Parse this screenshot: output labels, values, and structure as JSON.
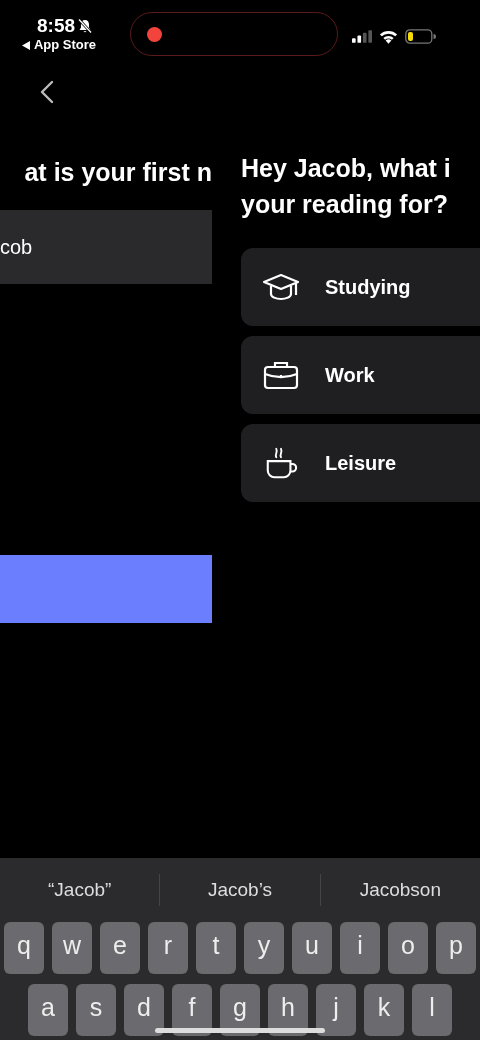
{
  "status_bar": {
    "time": "8:58",
    "back_label": "App Store"
  },
  "previous_page": {
    "heading": "at is your first n",
    "name_field": {
      "value": "cob"
    }
  },
  "current_page": {
    "heading_lines": [
      "Hey Jacob, what i",
      "your reading for?"
    ],
    "options": [
      {
        "kind": "cap",
        "label": "Studying"
      },
      {
        "kind": "briefcase",
        "label": "Work"
      },
      {
        "kind": "cup",
        "label": "Leisure"
      }
    ]
  },
  "keyboard": {
    "suggestions": [
      "“Jacob”",
      "Jacob’s",
      "Jacobson"
    ],
    "rows": [
      [
        "q",
        "w",
        "e",
        "r",
        "t",
        "y",
        "u",
        "i",
        "o",
        "p"
      ],
      [
        "a",
        "s",
        "d",
        "f",
        "g",
        "h",
        "j",
        "k",
        "l"
      ]
    ]
  }
}
